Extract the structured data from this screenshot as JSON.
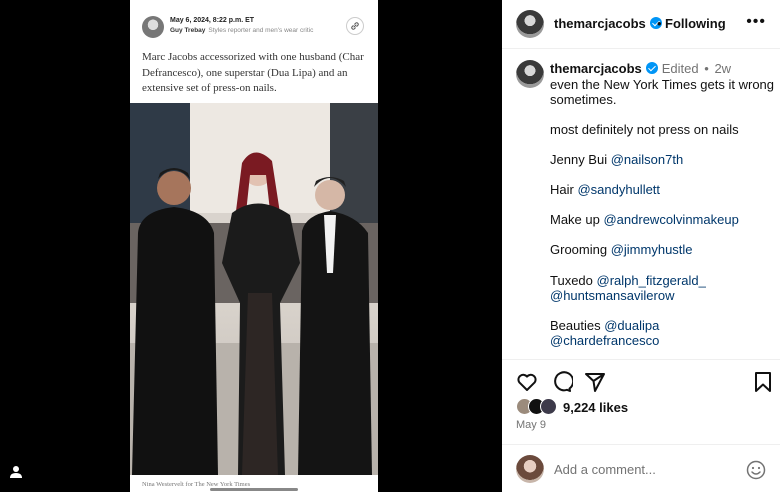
{
  "article": {
    "date": "May 6, 2024, 8:22 p.m. ET",
    "author": "Guy Trebay",
    "author_role": "Styles reporter and men's wear critic",
    "text": "Marc Jacobs accessorized with one husband (Char Defrancesco), one superstar (Dua Lipa) and an extensive set of press-on nails.",
    "caption": "Nina Westervelt for The New York Times"
  },
  "header": {
    "username": "themarcjacobs",
    "separator": "•",
    "follow_label": "Following",
    "more_label": "•••"
  },
  "caption": {
    "username": "themarcjacobs",
    "edited": "Edited",
    "dot": "•",
    "time": "2w",
    "lines": [
      {
        "text": "even the New York Times gets it wrong"
      },
      {
        "text": "sometimes."
      },
      {
        "text": "most definitely not press on nails"
      },
      {
        "prefix": "Jenny Bui ",
        "mention": "@nailson7th"
      },
      {
        "prefix": "Hair ",
        "mention": "@sandyhullett"
      },
      {
        "prefix": "Make up ",
        "mention": "@andrewcolvinmakeup"
      },
      {
        "prefix": "Grooming ",
        "mention": "@jimmyhustle"
      },
      {
        "prefix": "Tuxedo ",
        "mention": "@ralph_fitzgerald_"
      },
      {
        "mention": "@huntsmansavilerow"
      },
      {
        "prefix": "Beauties ",
        "mention": "@dualipa"
      },
      {
        "mention": "@chardefrancesco"
      }
    ]
  },
  "actions": {
    "icons": [
      "heart-icon",
      "comment-icon",
      "share-icon",
      "bookmark-icon"
    ]
  },
  "likes": {
    "count_label": "9,224 likes"
  },
  "post_date": "May 9",
  "add_comment": {
    "placeholder": "Add a comment..."
  },
  "colors": {
    "verified": "#0095f6",
    "mention": "#00376b",
    "secondary_text": "#737373"
  }
}
